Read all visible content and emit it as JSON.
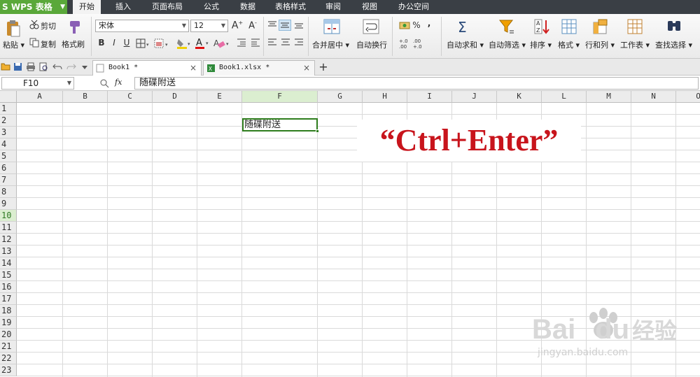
{
  "app": {
    "button_label": "WPS 表格",
    "logo_letter": "S"
  },
  "menu_tabs": [
    "开始",
    "插入",
    "页面布局",
    "公式",
    "数据",
    "表格样式",
    "审阅",
    "视图",
    "办公空间"
  ],
  "ribbon": {
    "paste": "粘贴",
    "cut": "剪切",
    "copy": "复制",
    "format_painter": "格式刷",
    "font_name": "宋体",
    "font_size": "12",
    "bold": "B",
    "italic": "I",
    "underline": "U",
    "merge_center": "合并居中",
    "wrap_text": "自动换行",
    "percent": "%",
    "comma": ",",
    "autosum": "自动求和",
    "autofilter": "自动筛选",
    "sort": "排序",
    "format": "格式",
    "rows_cols": "行和列",
    "worksheet": "工作表",
    "find_select": "查找选择"
  },
  "doc_tabs": [
    {
      "label": "Book1 *"
    },
    {
      "label": "Book1.xlsx *"
    }
  ],
  "formula_bar": {
    "cell_ref": "F10",
    "fx_label": "fx",
    "content": "随碟附送"
  },
  "sheet": {
    "columns": [
      "A",
      "B",
      "C",
      "D",
      "E",
      "F",
      "G",
      "H",
      "I",
      "J",
      "K",
      "L",
      "M",
      "N",
      "O"
    ],
    "rows": [
      "1",
      "2",
      "3",
      "4",
      "5",
      "6",
      "7",
      "8",
      "9",
      "10",
      "11",
      "12",
      "13",
      "14",
      "15",
      "16",
      "17",
      "18",
      "19",
      "20",
      "21",
      "22",
      "23"
    ],
    "selected_column": "F",
    "selected_row": "10",
    "active_cell_value": "随碟附送"
  },
  "caption": "“Ctrl+Enter”",
  "watermark": {
    "brand": "Bai",
    "brand2": "du",
    "brand_cn": "经验",
    "url": "jingyan.baidu.com"
  },
  "colors": {
    "accent_green": "#5aa83a",
    "selection_green": "#2e7d1d",
    "caption_red": "#c8141c"
  }
}
